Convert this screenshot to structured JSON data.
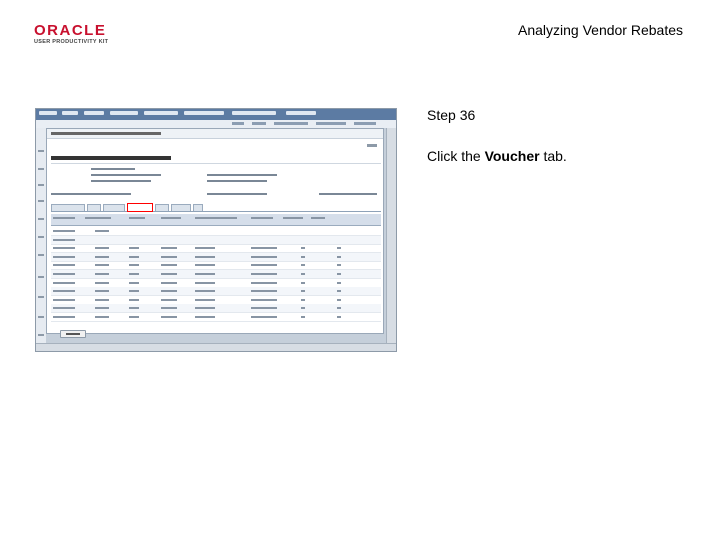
{
  "header": {
    "brand_line1": "ORACLE",
    "brand_line2": "USER PRODUCTIVITY KIT",
    "title": "Analyzing Vendor Rebates"
  },
  "step": {
    "label": "Step 36",
    "instruction_prefix": "Click the ",
    "instruction_target": "Voucher",
    "instruction_suffix": " tab."
  },
  "colors": {
    "brand_red": "#c8102e",
    "highlight": "#ff0000",
    "app_frame": "#5c7ba3"
  },
  "screenshot": {
    "highlighted_tab": "Voucher",
    "grid_rows": 11
  }
}
